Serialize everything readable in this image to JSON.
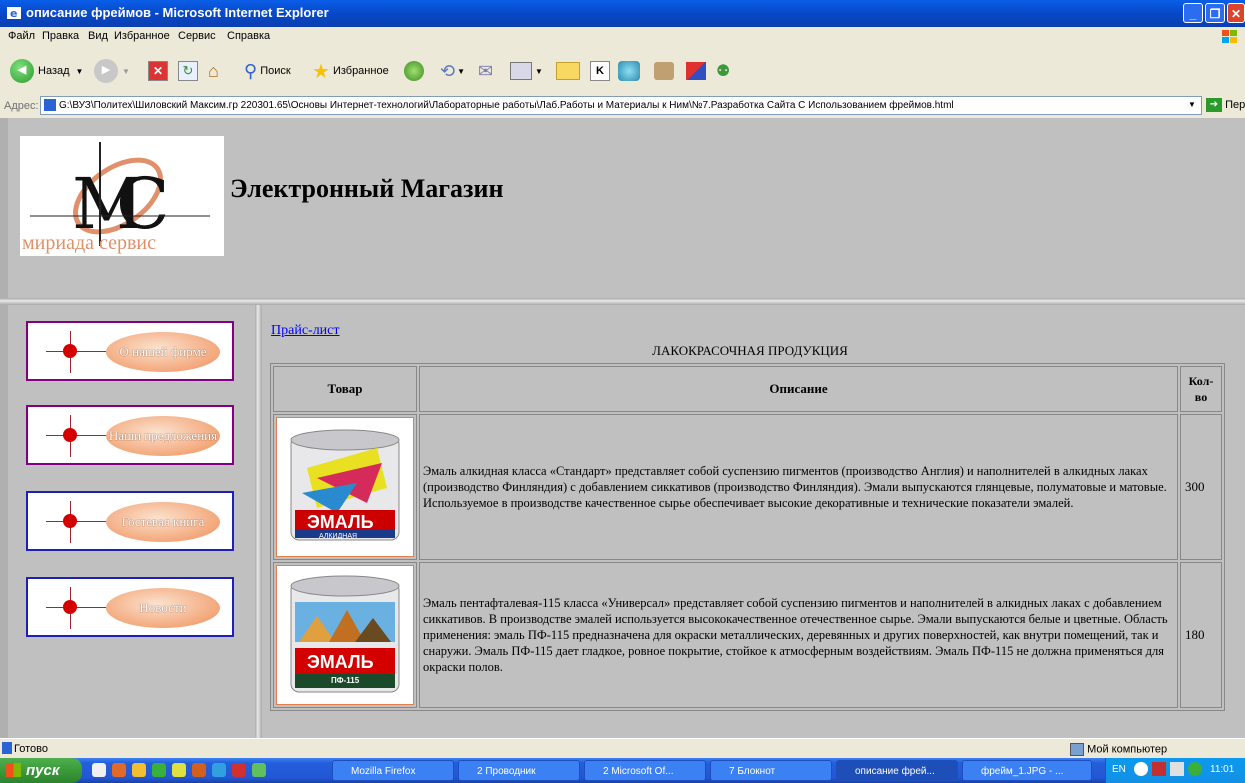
{
  "window": {
    "title": "описание фреймов - Microsoft Internet Explorer"
  },
  "menu": [
    "Файл",
    "Правка",
    "Вид",
    "Избранное",
    "Сервис",
    "Справка"
  ],
  "toolbar": {
    "back_label": "Назад",
    "search_label": "Поиск",
    "favorites_label": "Избранное"
  },
  "address": {
    "label": "Адрес:",
    "url": "G:\\ВУЗ\\Политех\\Шиловский Максим.гр 220301.65\\Основы Интернет-технологий\\Лабораторные работы\\Лаб.Работы и Материалы к Ним\\№7.Разработка Сайта С Использованием фреймов.html",
    "go_label": "Переход"
  },
  "header": {
    "logo_text": "мириада сервис",
    "site_title": "Электронный Магазин"
  },
  "nav": [
    {
      "label": "О нашей фирме"
    },
    {
      "label": "Наши предложения"
    },
    {
      "label": "Гостевая книга"
    },
    {
      "label": "Новости"
    }
  ],
  "main": {
    "price_link": "Прайс-лист",
    "caption": "ЛАКОКРАСОЧНАЯ ПРОДУКЦИЯ",
    "columns": {
      "product": "Товар",
      "description": "Описание",
      "qty": "Кол-во"
    },
    "products": [
      {
        "can_label": "ЭМАЛЬ",
        "can_sublabel": "АЛКИДНАЯ",
        "description": "Эмаль алкидная класса «Стандарт» представляет собой суспензию пигментов (производство Англия) и наполнителей в алкидных лаках (производство Финляндия) с добавлением сиккативов (производство Финляндия). Эмали выпускаются глянцевые, полуматовые и матовые. Используемое в производстве качественное сырье обеспечивает высокие декоративные и технические показатели эмалей.",
        "qty": "300"
      },
      {
        "can_label": "ЭМАЛЬ",
        "can_sublabel": "ПФ-115",
        "description": "Эмаль пентафталевая-115 класса «Универсал» представляет собой суспензию пигментов и наполнителей в алкидных лаках с добавлением сиккативов. В производстве эмалей используется высококачественное отечественное сырье. Эмали выпускаются белые и цветные. Область применения: эмаль ПФ-115 предназначена для окраски металлических, деревянных и других поверхностей, как внутри помещений, так и снаружи. Эмаль ПФ-115 дает гладкое, ровное покрытие, стойкое к атмосферным воздействиям. Эмаль ПФ-115 не должна применяться для окраски полов.",
        "qty": "180"
      }
    ]
  },
  "status": {
    "text": "Готово",
    "zone": "Мой компьютер"
  },
  "taskbar": {
    "start": "пуск",
    "tasks": [
      "Mozilla Firefox",
      "2 Проводник",
      "2 Microsoft Of...",
      "7 Блокнот",
      "описание фрей...",
      "фрейм_1.JPG - ..."
    ],
    "lang": "EN",
    "time": "11:01"
  },
  "colors": {
    "nav_border_purple": "#800080",
    "nav_border_blue": "#1e1ebf",
    "link": "#0000ff",
    "frame_bg": "#c0c0c0"
  }
}
